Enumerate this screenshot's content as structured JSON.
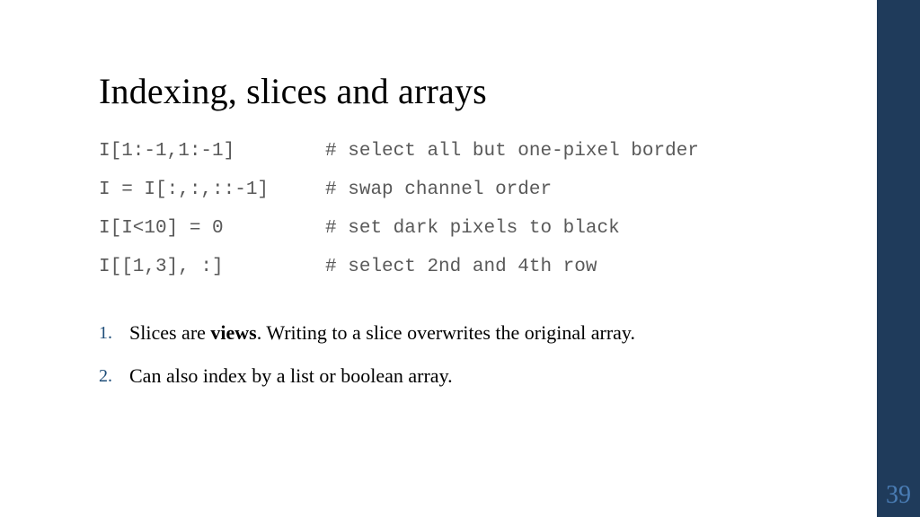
{
  "title": "Indexing, slices and arrays",
  "code": {
    "line1": "I[1:-1,1:-1]        # select all but one-pixel border",
    "line2": "I = I[:,:,::-1]     # swap channel order",
    "line3": "I[I<10] = 0         # set dark pixels to black",
    "line4": "I[[1,3], :]         # select 2nd and 4th row"
  },
  "notes": {
    "n1_num": "1.",
    "n1_a": "Slices are ",
    "n1_b": "views",
    "n1_c": ". Writing to a slice overwrites the original array.",
    "n2_num": "2.",
    "n2": "Can also index by a list or boolean array."
  },
  "page": "39"
}
